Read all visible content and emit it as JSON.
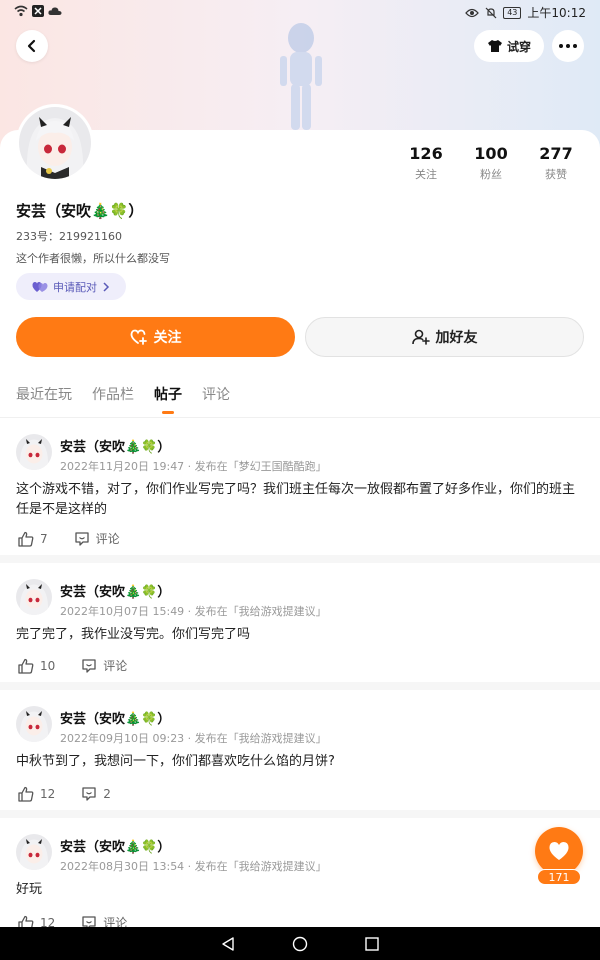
{
  "status_bar": {
    "time": "上午10:12",
    "battery": "43"
  },
  "header": {
    "try_on_label": "试穿"
  },
  "profile": {
    "name": "安芸（安吹🎄🍀）",
    "uid": "233号：219921160",
    "bio": "这个作者很懒，所以什么都没写",
    "pair_label": "申请配对",
    "stats": [
      {
        "num": "126",
        "label": "关注"
      },
      {
        "num": "100",
        "label": "粉丝"
      },
      {
        "num": "277",
        "label": "获赞"
      }
    ]
  },
  "actions": {
    "follow_label": "关注",
    "add_friend_label": "加好友"
  },
  "tabs": [
    {
      "label": "最近在玩"
    },
    {
      "label": "作品栏"
    },
    {
      "label": "帖子"
    },
    {
      "label": "评论"
    }
  ],
  "posts": [
    {
      "author": "安芸（安吹🎄🍀）",
      "meta": "2022年11月20日 19:47 · 发布在「梦幻王国酷酷跑」",
      "text": "这个游戏不错，对了，你们作业写完了吗？我们班主任每次一放假都布置了好多作业，你们的班主任是不是这样的",
      "likes": "7",
      "comments": "评论"
    },
    {
      "author": "安芸（安吹🎄🍀）",
      "meta": "2022年10月07日 15:49 · 发布在「我给游戏提建议」",
      "text": "完了完了，我作业没写完。你们写完了吗",
      "likes": "10",
      "comments": "评论"
    },
    {
      "author": "安芸（安吹🎄🍀）",
      "meta": "2022年09月10日 09:23 · 发布在「我给游戏提建议」",
      "text": "中秋节到了，我想问一下，你们都喜欢吃什么馅的月饼?",
      "likes": "12",
      "comments": "2"
    },
    {
      "author": "安芸（安吹🎄🍀）",
      "meta": "2022年08月30日 13:54 · 发布在「我给游戏提建议」",
      "text": "好玩",
      "likes": "12",
      "comments": "评论"
    }
  ],
  "fab": {
    "count": "171"
  },
  "colors": {
    "accent": "#ff7a14",
    "pair_bg": "#efeefb",
    "pair_text": "#5a5ab8"
  }
}
